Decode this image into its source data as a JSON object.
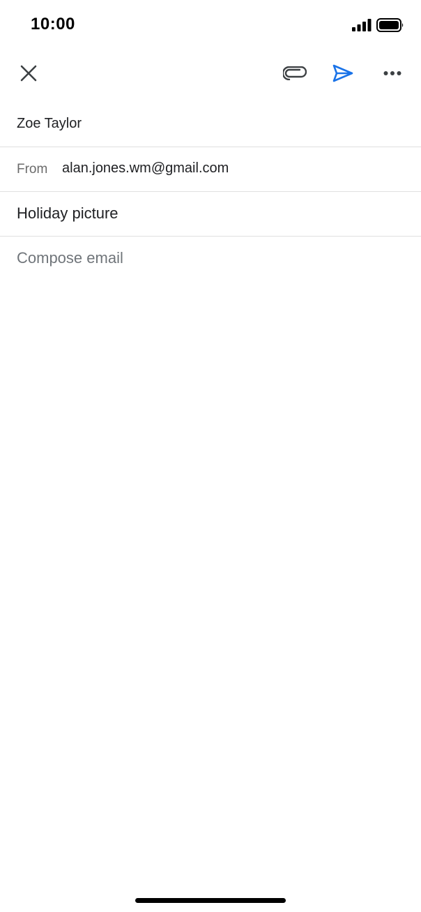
{
  "status_bar": {
    "time": "10:00"
  },
  "toolbar": {
    "close_icon": "close-icon",
    "attach_icon": "paperclip-icon",
    "send_icon": "send-icon",
    "more_icon": "more-horizontal-icon",
    "send_color": "#1a73e8"
  },
  "compose": {
    "to": "Zoe Taylor",
    "from_label": "From",
    "from_value": "alan.jones.wm@gmail.com",
    "subject": "Holiday picture",
    "body_placeholder": "Compose email"
  }
}
